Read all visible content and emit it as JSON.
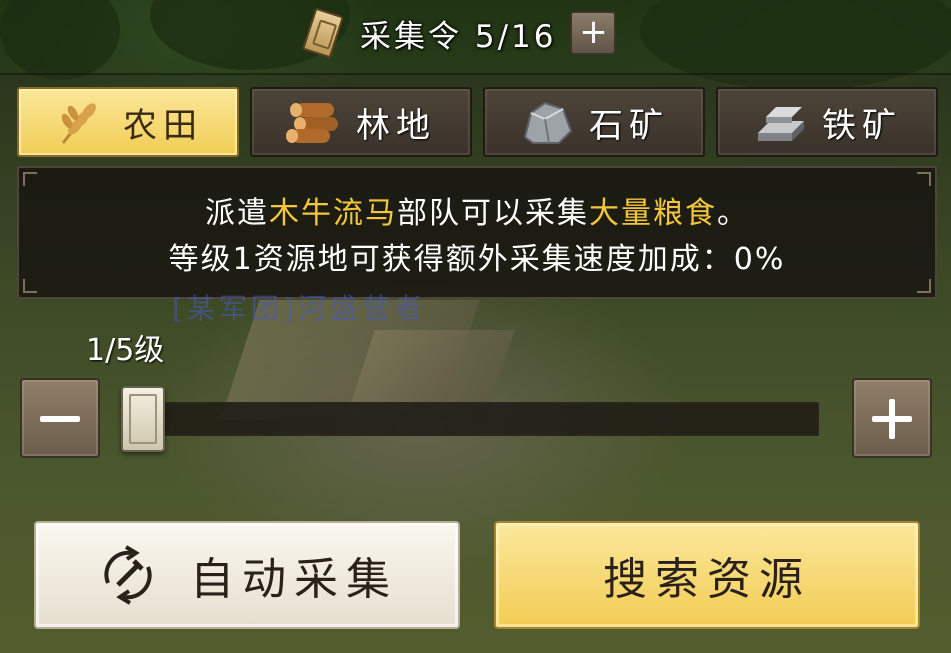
{
  "header": {
    "ticket_text": "采集令 5/16",
    "plus_label": "+"
  },
  "tabs": [
    {
      "label": "农田",
      "icon": "wheat-icon",
      "active": true
    },
    {
      "label": "林地",
      "icon": "logs-icon",
      "active": false
    },
    {
      "label": "石矿",
      "icon": "stone-icon",
      "active": false
    },
    {
      "label": "铁矿",
      "icon": "iron-ingot-icon",
      "active": false
    }
  ],
  "info": {
    "line1_a": "派遣",
    "line1_b": "木牛流马",
    "line1_c": "部队可以采集",
    "line1_d": "大量粮食",
    "line1_e": "。",
    "line2": "等级1资源地可获得额外采集速度加成：0%"
  },
  "background_text": "[某军团]河盛营者",
  "level": {
    "label": "1/5级",
    "current": 1,
    "max": 5,
    "minus_icon": "minus-icon",
    "plus_icon": "plus-icon"
  },
  "buttons": {
    "auto_collect": "自动采集",
    "auto_collect_icon": "auto-cycle-icon",
    "search_resource": "搜索资源"
  },
  "colors": {
    "active_tab": "#f0cd55",
    "highlight_text": "#f3c63c",
    "search_button": "#f2cc53",
    "auto_button": "#e6dfcf"
  }
}
